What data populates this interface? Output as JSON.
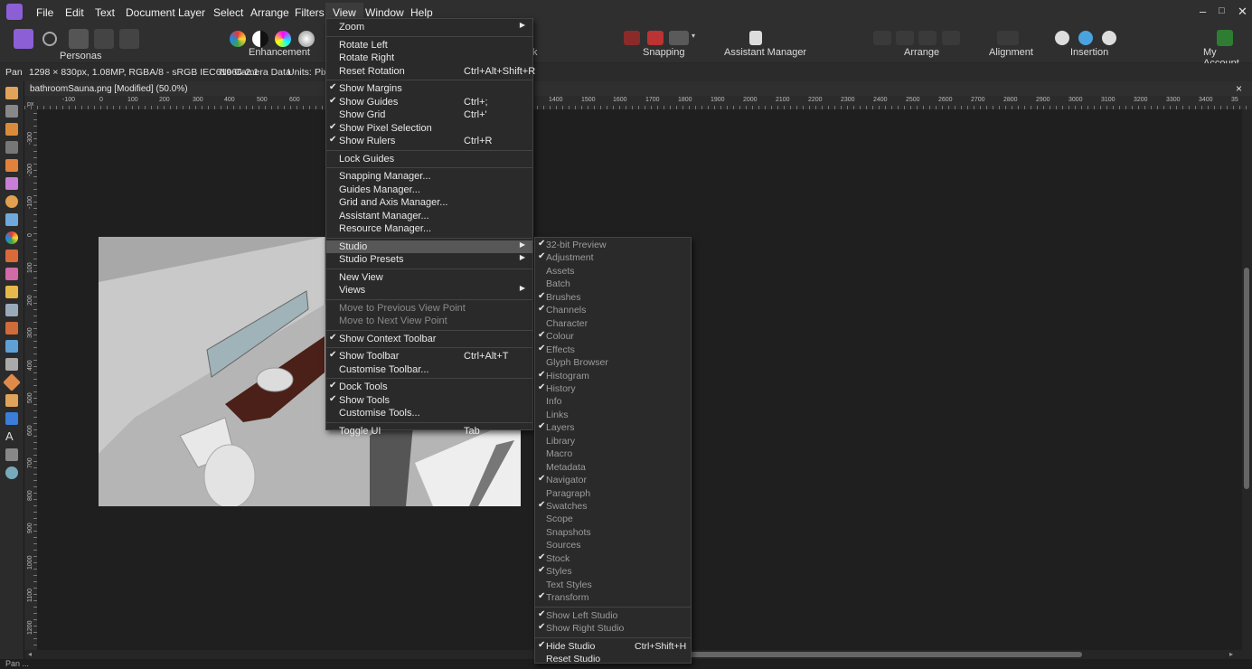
{
  "menubar": {
    "items": [
      "File",
      "Edit",
      "Text",
      "Document",
      "Layer",
      "Select",
      "Arrange",
      "Filters",
      "View",
      "Window",
      "Help"
    ],
    "window_controls": [
      "–",
      "□",
      "✕"
    ]
  },
  "toolbar": {
    "groups": {
      "personas": "Personas",
      "enhancement": "Enhancement",
      "snapping": "Snapping",
      "assistant": "Assistant Manager",
      "arrange": "Arrange",
      "alignment": "Alignment",
      "insertion": "Insertion",
      "account": "My Account"
    },
    "partial_label": "k"
  },
  "context": {
    "tool": "Pan",
    "info": "1298 × 830px, 1.08MP, RGBA/8 - sRGB IEC61966-2.1",
    "camera": "No Camera Data",
    "units_label": "Units:",
    "units_value": "Pix"
  },
  "document": {
    "tab_title": "bathroomSauna.png [Modified] (50.0%)",
    "close": "×",
    "ruler_unit": "px"
  },
  "ruler": {
    "top": [
      "-100",
      "0",
      "100",
      "200",
      "300",
      "400",
      "500",
      "600",
      "1400",
      "1500",
      "1600",
      "1700",
      "1800",
      "1900",
      "2000",
      "2100",
      "2200",
      "2300",
      "2400",
      "2500",
      "2600",
      "2700",
      "2800",
      "2900",
      "3000",
      "3100",
      "3200",
      "3300",
      "3400",
      "35"
    ],
    "left": [
      "-300",
      "-200",
      "-100",
      "0",
      "100",
      "200",
      "300",
      "400",
      "500",
      "600",
      "700",
      "800",
      "900",
      "1000",
      "1100",
      "1200"
    ]
  },
  "view_menu": {
    "items": [
      {
        "label": "Zoom",
        "submenu": true
      },
      {
        "sep": true
      },
      {
        "label": "Rotate Left"
      },
      {
        "label": "Rotate Right"
      },
      {
        "label": "Reset Rotation",
        "shortcut": "Ctrl+Alt+Shift+R"
      },
      {
        "sep": true
      },
      {
        "label": "Show Margins",
        "checked": true
      },
      {
        "label": "Show Guides",
        "checked": true,
        "shortcut": "Ctrl+;"
      },
      {
        "label": "Show Grid",
        "shortcut": "Ctrl+'"
      },
      {
        "label": "Show Pixel Selection",
        "checked": true
      },
      {
        "label": "Show Rulers",
        "checked": true,
        "shortcut": "Ctrl+R"
      },
      {
        "sep": true
      },
      {
        "label": "Lock Guides"
      },
      {
        "sep": true
      },
      {
        "label": "Snapping Manager..."
      },
      {
        "label": "Guides Manager..."
      },
      {
        "label": "Grid and Axis Manager..."
      },
      {
        "label": "Assistant Manager..."
      },
      {
        "label": "Resource Manager..."
      },
      {
        "sep": true
      },
      {
        "label": "Studio",
        "submenu": true,
        "highlight": true
      },
      {
        "label": "Studio Presets",
        "submenu": true
      },
      {
        "sep": true
      },
      {
        "label": "New View"
      },
      {
        "label": "Views",
        "submenu": true
      },
      {
        "sep": true
      },
      {
        "label": "Move to Previous View Point",
        "disabled": true
      },
      {
        "label": "Move to Next View Point",
        "disabled": true
      },
      {
        "sep": true
      },
      {
        "label": "Show Context Toolbar",
        "checked": true
      },
      {
        "sep": true
      },
      {
        "label": "Show Toolbar",
        "checked": true,
        "shortcut": "Ctrl+Alt+T"
      },
      {
        "label": "Customise Toolbar..."
      },
      {
        "sep": true
      },
      {
        "label": "Dock Tools",
        "checked": true
      },
      {
        "label": "Show Tools",
        "checked": true
      },
      {
        "label": "Customise Tools..."
      },
      {
        "sep": true
      },
      {
        "label": "Toggle UI",
        "shortcut": "Tab"
      }
    ]
  },
  "studio_menu": {
    "items": [
      {
        "label": "32-bit Preview",
        "checked": true
      },
      {
        "label": "Adjustment",
        "checked": true
      },
      {
        "label": "Assets"
      },
      {
        "label": "Batch"
      },
      {
        "label": "Brushes",
        "checked": true
      },
      {
        "label": "Channels",
        "checked": true
      },
      {
        "label": "Character"
      },
      {
        "label": "Colour",
        "checked": true
      },
      {
        "label": "Effects",
        "checked": true
      },
      {
        "label": "Glyph Browser"
      },
      {
        "label": "Histogram",
        "checked": true
      },
      {
        "label": "History",
        "checked": true
      },
      {
        "label": "Info"
      },
      {
        "label": "Links"
      },
      {
        "label": "Layers",
        "checked": true
      },
      {
        "label": "Library"
      },
      {
        "label": "Macro"
      },
      {
        "label": "Metadata"
      },
      {
        "label": "Navigator",
        "checked": true
      },
      {
        "label": "Paragraph"
      },
      {
        "label": "Swatches",
        "checked": true
      },
      {
        "label": "Scope"
      },
      {
        "label": "Snapshots"
      },
      {
        "label": "Sources"
      },
      {
        "label": "Stock",
        "checked": true
      },
      {
        "label": "Styles",
        "checked": true
      },
      {
        "label": "Text Styles"
      },
      {
        "label": "Transform",
        "checked": true
      },
      {
        "sep": true
      },
      {
        "label": "Show Left Studio",
        "checked": true
      },
      {
        "label": "Show Right Studio",
        "checked": true
      },
      {
        "sep": true
      },
      {
        "label": "Hide Studio",
        "checked": true,
        "shortcut": "Ctrl+Shift+H",
        "bright": true
      },
      {
        "label": "Reset Studio",
        "bright": true
      }
    ]
  },
  "status": {
    "text": "Pan ..."
  }
}
